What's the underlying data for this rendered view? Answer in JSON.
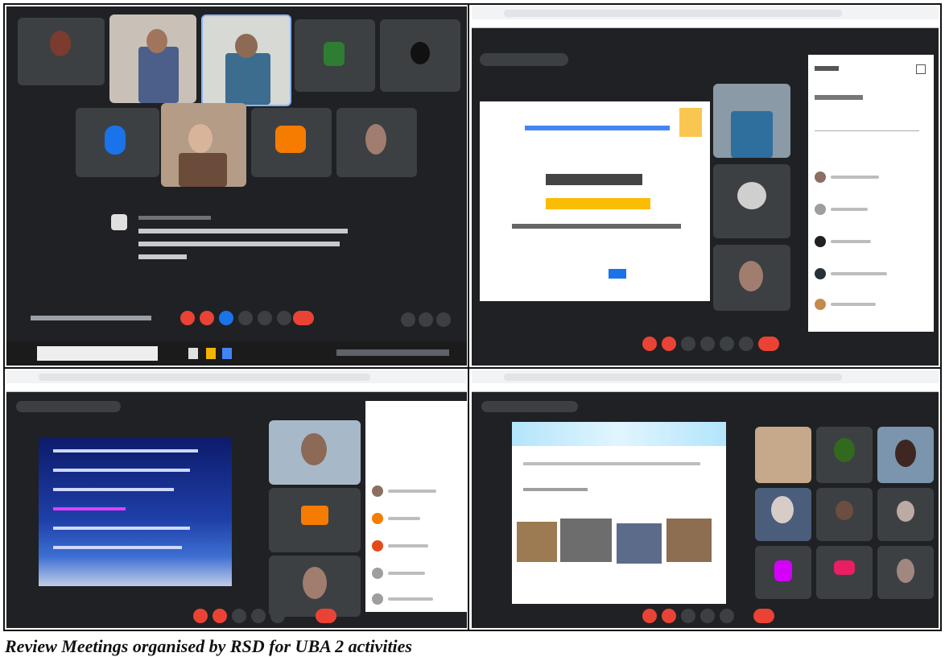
{
  "caption": "Review Meetings organised by RSD for UBA 2 activities",
  "colors": {
    "meet_background": "#202124",
    "tile": "#3c4043",
    "end_call": "#ea4335",
    "accent_blue": "#1a73e8",
    "caption_text": "#111111"
  },
  "screenshots": [
    {
      "position": "top-left",
      "app": "video-meeting",
      "content": "participant-grid-with-chat-message"
    },
    {
      "position": "top-right",
      "app": "video-meeting",
      "content": "shared-slide-with-participant-panel"
    },
    {
      "position": "bottom-left",
      "app": "video-meeting",
      "content": "shared-blue-slide-with-participant-panel"
    },
    {
      "position": "bottom-right",
      "app": "video-meeting",
      "content": "shared-photo-slide-with-participant-grid"
    }
  ]
}
